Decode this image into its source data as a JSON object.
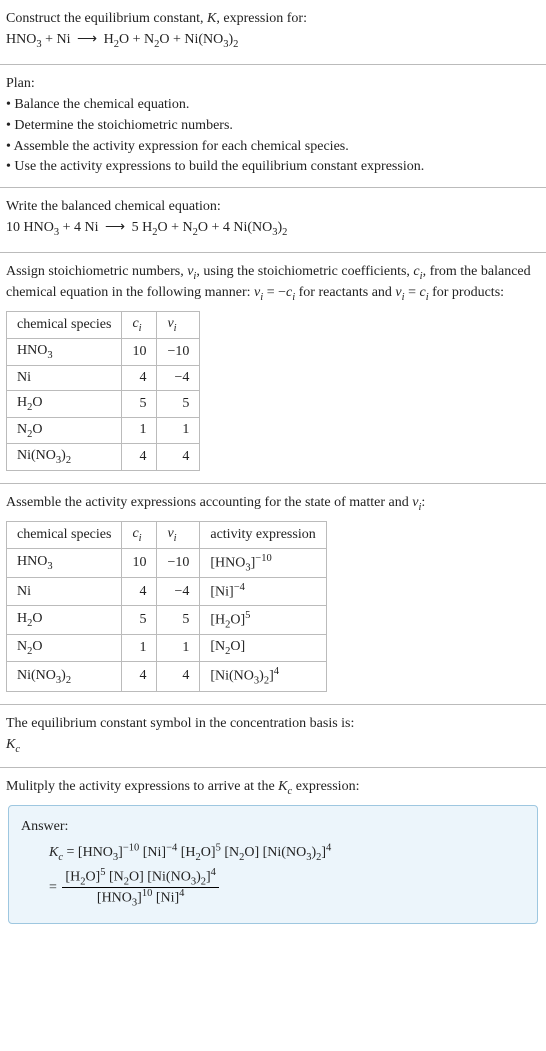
{
  "intro": {
    "line1_pre": "Construct the equilibrium constant, ",
    "line1_K": "K",
    "line1_post": ", expression for:",
    "equation_plain": "HNO₃ + Ni ⟶ H₂O + N₂O + Ni(NO₃)₂"
  },
  "plan": {
    "heading": "Plan:",
    "b1": "• Balance the chemical equation.",
    "b2": "• Determine the stoichiometric numbers.",
    "b3": "• Assemble the activity expression for each chemical species.",
    "b4": "• Use the activity expressions to build the equilibrium constant expression."
  },
  "balanced": {
    "heading": "Write the balanced chemical equation:",
    "equation_plain": "10 HNO₃ + 4 Ni ⟶ 5 H₂O + N₂O + 4 Ni(NO₃)₂"
  },
  "assign": {
    "text_a": "Assign stoichiometric numbers, ",
    "nu": "ν",
    "sub_i": "i",
    "text_b": ", using the stoichiometric coefficients, ",
    "c": "c",
    "text_c": ", from the balanced chemical equation in the following manner: ",
    "rel1_pre": "ν",
    "rel1_mid": " = −",
    "rel1_c": "c",
    "text_d": " for reactants and ",
    "rel2_mid": " = ",
    "text_e": " for products:"
  },
  "table1": {
    "h_species": "chemical species",
    "h_ci": "c",
    "h_nu": "ν",
    "h_sub": "i",
    "rows": [
      {
        "sp": "HNO₃",
        "ci": "10",
        "nu": "−10"
      },
      {
        "sp": "Ni",
        "ci": "4",
        "nu": "−4"
      },
      {
        "sp": "H₂O",
        "ci": "5",
        "nu": "5"
      },
      {
        "sp": "N₂O",
        "ci": "1",
        "nu": "1"
      },
      {
        "sp": "Ni(NO₃)₂",
        "ci": "4",
        "nu": "4"
      }
    ]
  },
  "assemble": {
    "text_a": "Assemble the activity expressions accounting for the state of matter and ",
    "nu": "ν",
    "sub_i": "i",
    "text_b": ":"
  },
  "table2": {
    "h_species": "chemical species",
    "h_ci": "c",
    "h_nu": "ν",
    "h_sub": "i",
    "h_act": "activity expression",
    "rows": [
      {
        "sp": "HNO₃",
        "ci": "10",
        "nu": "−10",
        "act": "[HNO₃]⁻¹⁰"
      },
      {
        "sp": "Ni",
        "ci": "4",
        "nu": "−4",
        "act": "[Ni]⁻⁴"
      },
      {
        "sp": "H₂O",
        "ci": "5",
        "nu": "5",
        "act": "[H₂O]⁵"
      },
      {
        "sp": "N₂O",
        "ci": "1",
        "nu": "1",
        "act": "[N₂O]"
      },
      {
        "sp": "Ni(NO₃)₂",
        "ci": "4",
        "nu": "4",
        "act": "[Ni(NO₃)₂]⁴"
      }
    ]
  },
  "symbol": {
    "line": "The equilibrium constant symbol in the concentration basis is:",
    "K": "K",
    "Ksub": "c"
  },
  "multiply": {
    "text_a": "Mulitply the activity expressions to arrive at the ",
    "K": "K",
    "Ksub": "c",
    "text_b": " expression:"
  },
  "answer": {
    "heading": "Answer:",
    "K": "K",
    "Ksub": "c",
    "eq": " = ",
    "flat": "[HNO₃]⁻¹⁰ [Ni]⁻⁴ [H₂O]⁵ [N₂O] [Ni(NO₃)₂]⁴",
    "frac_num": "[H₂O]⁵ [N₂O] [Ni(NO₃)₂]⁴",
    "frac_den": "[HNO₃]¹⁰ [Ni]⁴"
  }
}
